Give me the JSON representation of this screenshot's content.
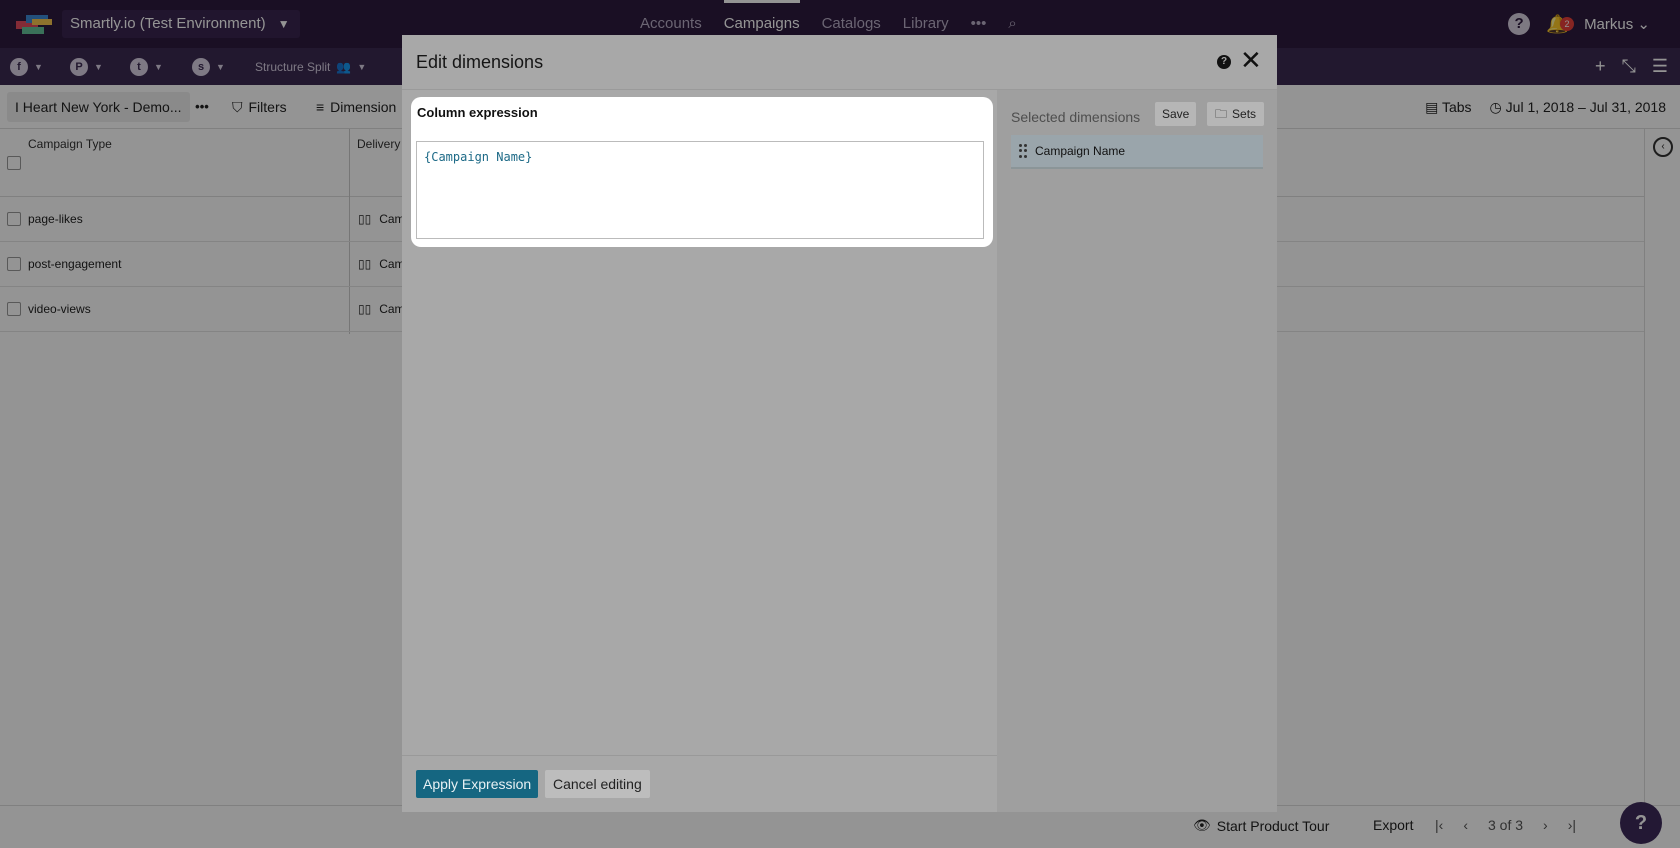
{
  "topnav": {
    "workspace": "Smartly.io (Test Environment)",
    "nav_items": [
      "Accounts",
      "Campaigns",
      "Catalogs",
      "Library"
    ],
    "more": "•••",
    "user": "Markus",
    "notification_count": "2",
    "help": "?"
  },
  "platformbar": {
    "structure_split": "Structure Split"
  },
  "toolbar": {
    "report_name": "I Heart New York - Demo...",
    "report_more": "•••",
    "filters": "Filters",
    "dimensions": "Dimension",
    "tabs": "Tabs",
    "date_range": "Jul 1, 2018 – Jul 31, 2018"
  },
  "table": {
    "columns": [
      "Campaign Type",
      "Delivery"
    ],
    "rows": [
      {
        "type": "page-likes",
        "cam": "Cam"
      },
      {
        "type": "post-engagement",
        "cam": "Cam"
      },
      {
        "type": "video-views",
        "cam": "Cam"
      }
    ]
  },
  "footer": {
    "tour": "Start Product Tour",
    "export": "Export",
    "page": "3 of 3"
  },
  "modal": {
    "title": "Edit dimensions",
    "help": "?",
    "column_expression_label": "Column expression",
    "expression": "{Campaign Name}",
    "selected_dimensions_label": "Selected dimensions",
    "save": "Save",
    "sets": "Sets",
    "dimensions": [
      "Campaign Name"
    ],
    "apply": "Apply Expression",
    "cancel": "Cancel editing"
  },
  "colors": {
    "nav_bg": "#2d1a3e",
    "accent": "#156681"
  }
}
